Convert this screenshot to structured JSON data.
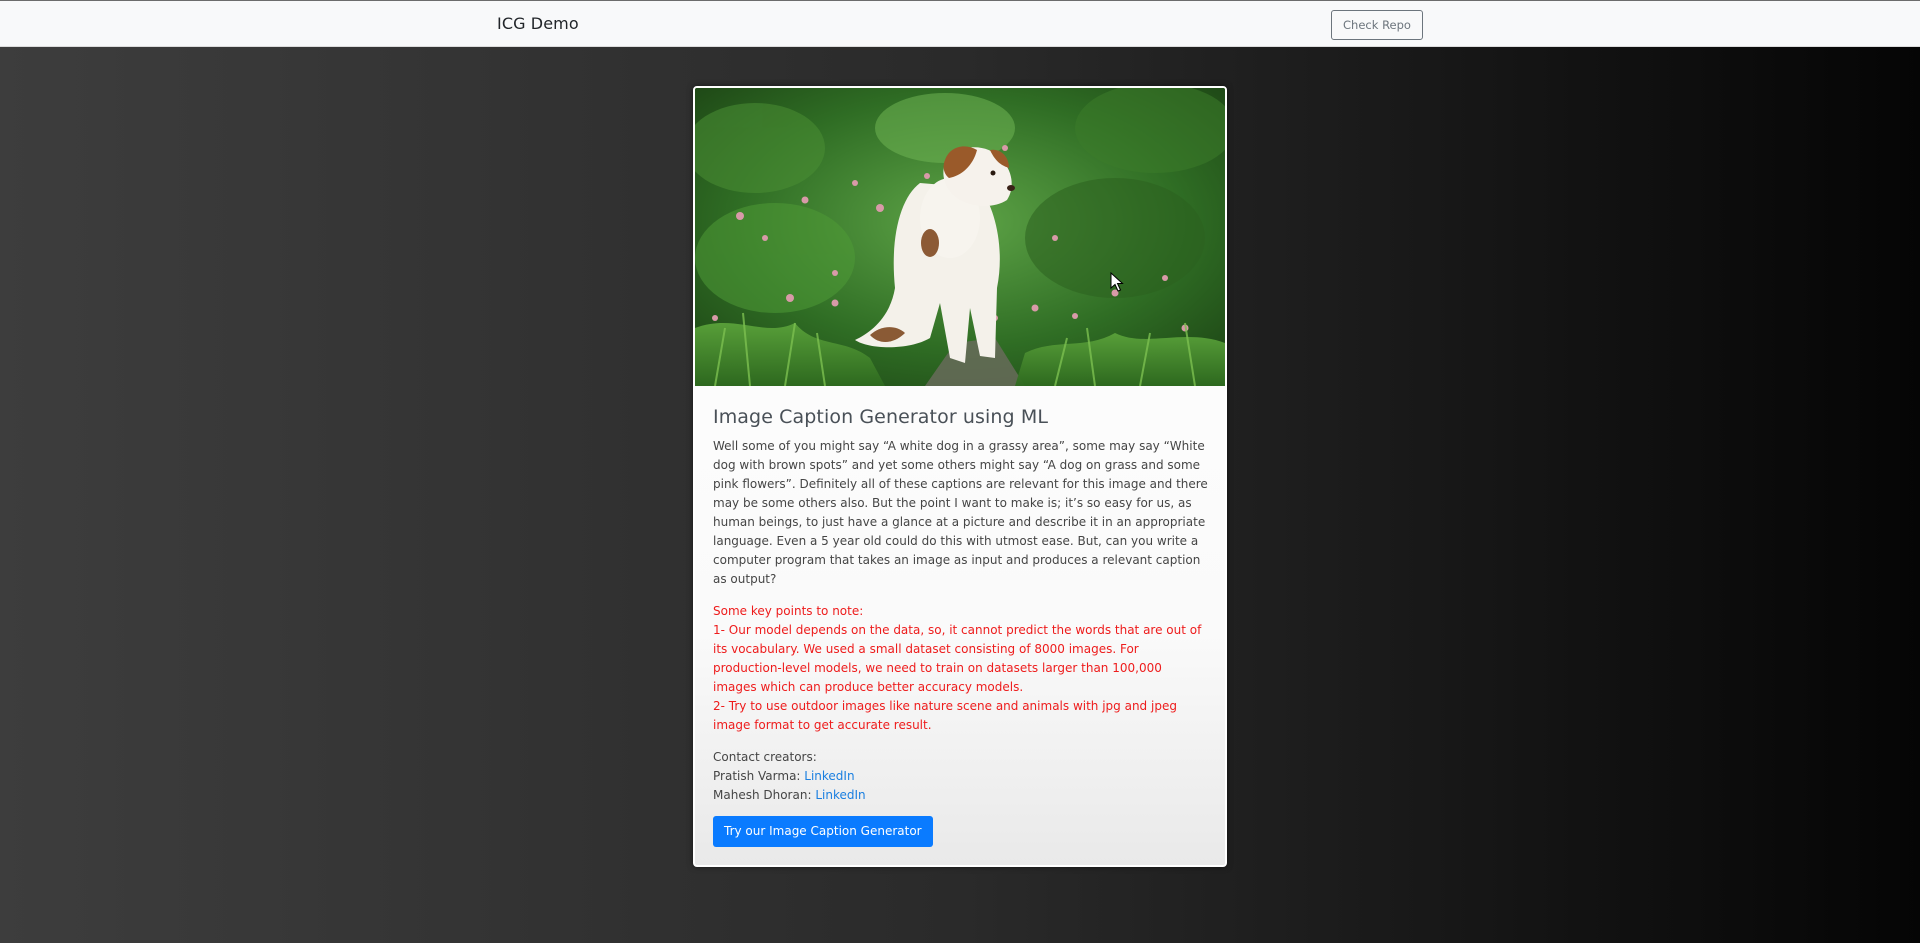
{
  "navbar": {
    "brand": "ICG Demo",
    "check_repo_label": "Check Repo"
  },
  "card": {
    "image_icon": "puppy-photo",
    "title": "Image Caption Generator using ML",
    "description": "Well some of you might say “A white dog in a grassy area”, some may say “White dog with brown spots” and yet some others might say “A dog on grass and some pink flowers”. Definitely all of these captions are relevant for this image and there may be some others also. But the point I want to make is; it’s so easy for us, as human beings, to just have a glance at a picture and describe it in an appropriate language. Even a 5 year old could do this with utmost ease. But, can you write a computer program that takes an image as input and produces a relevant caption as output?",
    "notes": {
      "heading": "Some key points to note:",
      "point1": "1- Our model depends on the data, so, it cannot predict the words that are out of its vocabulary. We used a small dataset consisting of 8000 images. For production-level models, we need to train on datasets larger than 100,000 images which can produce better accuracy models.",
      "point2": "2- Try to use outdoor images like nature scene and animals with jpg and jpeg image format to get accurate result."
    },
    "contact": {
      "heading": "Contact creators:",
      "creator1_name": "Pratish Varma: ",
      "creator1_link": "LinkedIn",
      "creator2_name": "Mahesh Dhoran: ",
      "creator2_link": "LinkedIn"
    },
    "cta_label": "Try our Image Caption Generator"
  },
  "colors": {
    "primary": "#0a7bff",
    "notes_red": "#ee1c1c",
    "link_blue": "#1a7fe0",
    "navbar_bg": "#f8f9fa"
  }
}
